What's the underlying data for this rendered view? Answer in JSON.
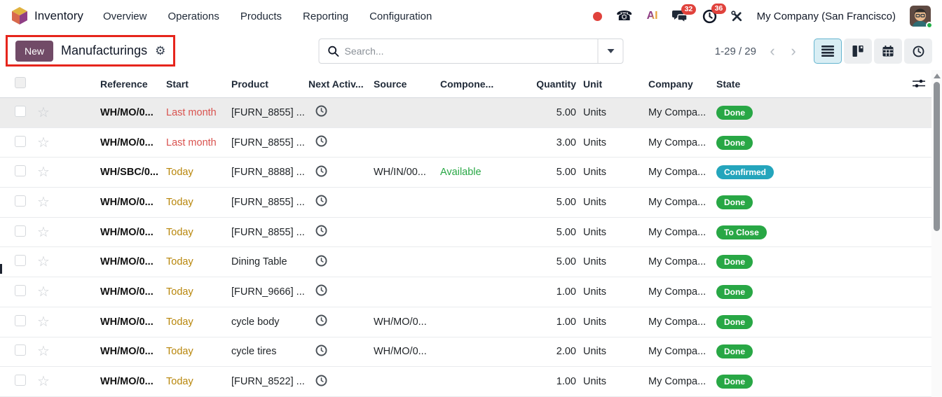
{
  "navbar": {
    "app_name": "Inventory",
    "menu_items": [
      "Overview",
      "Operations",
      "Products",
      "Reporting",
      "Configuration"
    ],
    "systray": {
      "ai_label": "AI",
      "chat_badge": "32",
      "activity_badge": "36",
      "company": "My Company (San Francisco)"
    }
  },
  "control_panel": {
    "new_button_label": "New",
    "title": "Manufacturings",
    "search": {
      "placeholder": "Search..."
    },
    "pager": {
      "display": "1-29 / 29"
    },
    "view_switcher": [
      "list",
      "kanban",
      "calendar",
      "activity"
    ],
    "active_view": "list"
  },
  "table": {
    "headers": [
      "Reference",
      "Start",
      "Product",
      "Next Activ...",
      "Source",
      "Compone...",
      "Quantity",
      "Unit",
      "Company",
      "State"
    ],
    "rows": [
      {
        "reference": "WH/MO/0...",
        "start": "Last month",
        "start_class": "danger",
        "product": "[FURN_8855] ...",
        "source": "",
        "component": "",
        "component_class": "",
        "quantity": "5.00",
        "unit": "Units",
        "company": "My Compa...",
        "state": "Done",
        "state_class": "success",
        "highlighted": true
      },
      {
        "reference": "WH/MO/0...",
        "start": "Last month",
        "start_class": "danger",
        "product": "[FURN_8855] ...",
        "source": "",
        "component": "",
        "component_class": "",
        "quantity": "3.00",
        "unit": "Units",
        "company": "My Compa...",
        "state": "Done",
        "state_class": "success",
        "highlighted": false
      },
      {
        "reference": "WH/SBC/0...",
        "start": "Today",
        "start_class": "warning",
        "product": "[FURN_8888] ...",
        "source": "WH/IN/00...",
        "component": "Available",
        "component_class": "success",
        "quantity": "5.00",
        "unit": "Units",
        "company": "My Compa...",
        "state": "Confirmed",
        "state_class": "info",
        "highlighted": false
      },
      {
        "reference": "WH/MO/0...",
        "start": "Today",
        "start_class": "warning",
        "product": "[FURN_8855] ...",
        "source": "",
        "component": "",
        "component_class": "",
        "quantity": "5.00",
        "unit": "Units",
        "company": "My Compa...",
        "state": "Done",
        "state_class": "success",
        "highlighted": false
      },
      {
        "reference": "WH/MO/0...",
        "start": "Today",
        "start_class": "warning",
        "product": "[FURN_8855] ...",
        "source": "",
        "component": "",
        "component_class": "",
        "quantity": "5.00",
        "unit": "Units",
        "company": "My Compa...",
        "state": "To Close",
        "state_class": "success",
        "highlighted": false
      },
      {
        "reference": "WH/MO/0...",
        "start": "Today",
        "start_class": "warning",
        "product": "Dining Table",
        "source": "",
        "component": "",
        "component_class": "",
        "quantity": "5.00",
        "unit": "Units",
        "company": "My Compa...",
        "state": "Done",
        "state_class": "success",
        "highlighted": false
      },
      {
        "reference": "WH/MO/0...",
        "start": "Today",
        "start_class": "warning",
        "product": "[FURN_9666] ...",
        "source": "",
        "component": "",
        "component_class": "",
        "quantity": "1.00",
        "unit": "Units",
        "company": "My Compa...",
        "state": "Done",
        "state_class": "success",
        "highlighted": false
      },
      {
        "reference": "WH/MO/0...",
        "start": "Today",
        "start_class": "warning",
        "product": "cycle body",
        "source": "WH/MO/0...",
        "component": "",
        "component_class": "",
        "quantity": "1.00",
        "unit": "Units",
        "company": "My Compa...",
        "state": "Done",
        "state_class": "success",
        "highlighted": false
      },
      {
        "reference": "WH/MO/0...",
        "start": "Today",
        "start_class": "warning",
        "product": "cycle tires",
        "source": "WH/MO/0...",
        "component": "",
        "component_class": "",
        "quantity": "2.00",
        "unit": "Units",
        "company": "My Compa...",
        "state": "Done",
        "state_class": "success",
        "highlighted": false
      },
      {
        "reference": "WH/MO/0...",
        "start": "Today",
        "start_class": "warning",
        "product": "[FURN_8522] ...",
        "source": "",
        "component": "",
        "component_class": "",
        "quantity": "1.00",
        "unit": "Units",
        "company": "My Compa...",
        "state": "Done",
        "state_class": "success",
        "highlighted": false
      }
    ]
  },
  "icons": {
    "star": "☆",
    "gear": "⚙",
    "phone": "☎",
    "chevron_left": "‹",
    "chevron_right": "›"
  },
  "colors": {
    "accent": "#714B67",
    "annotation_red": "#e6251c",
    "danger_text": "#d9534f",
    "warning_text": "#b8860b",
    "success_text": "#28a745",
    "badge_success": "#28a745",
    "badge_info": "#24a5bc",
    "active_view_bg": "#d9eef4",
    "notification_red": "#e0423c"
  }
}
